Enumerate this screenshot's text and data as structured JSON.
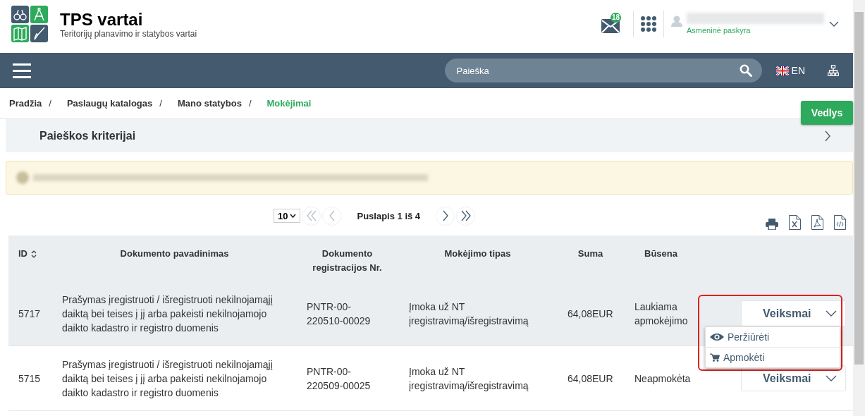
{
  "header": {
    "title": "TPS vartai",
    "subtitle": "Teritorijų planavimo ir statybos vartai",
    "mail_badge": "18",
    "account_label": "Asmeninė paskyra"
  },
  "navbar": {
    "search": {
      "placeholder": "Paieška"
    },
    "language": "EN"
  },
  "breadcrumb": [
    {
      "label": "Pradžia",
      "current": false,
      "separator": "/"
    },
    {
      "label": "Paslaugų katalogas",
      "current": false,
      "separator": "/"
    },
    {
      "label": "Mano statybos",
      "current": false,
      "separator": "/"
    },
    {
      "label": "Mokėjimai",
      "current": true
    }
  ],
  "wizard_button": "Vedlys",
  "search_panel": {
    "title": "Paieškos kriterijai",
    "expanded": false
  },
  "pagination": {
    "page_size": "10",
    "page_label": "Puslapis 1 iš 4"
  },
  "table": {
    "columns": [
      {
        "label": "ID",
        "sortable": true
      },
      {
        "label": "Dokumento pavadinimas",
        "sortable": false
      },
      {
        "label": "Dokumento registracijos Nr.",
        "sortable": false
      },
      {
        "label": "Mokėjimo tipas",
        "sortable": false
      },
      {
        "label": "Suma",
        "sortable": false
      },
      {
        "label": "Būsena",
        "sortable": false
      }
    ],
    "rows": [
      {
        "cells": [
          "5717",
          "Prašymas įregistruoti / išregistruoti nekilnojamąjį daiktą bei teises į jį arba pakeisti nekilnojamojo daikto kadastro ir registro duomenis",
          "PNTR-00-220510-00029",
          "Įmoka už NT įregistravimą/išregistravimą",
          "64,08EUR",
          "Laukiama apmokėjimo"
        ],
        "hovered": true,
        "actions": "Veiksmai",
        "menu_open": true,
        "menu": [
          {
            "kind": "view",
            "label": "Peržiūrėti"
          },
          {
            "kind": "pay",
            "label": "Apmokėti"
          }
        ]
      },
      {
        "cells": [
          "5715",
          "Prašymas įregistruoti / išregistruoti nekilnojamąjį daiktą bei teises į jį arba pakeisti nekilnojamojo daikto kadastro ir registro duomenis",
          "PNTR-00-220509-00025",
          "Įmoka už NT įregistravimą/išregistravimą",
          "64,08EUR",
          "Neapmokėta"
        ],
        "hovered": false,
        "actions": "Veiksmai",
        "menu_open": false
      }
    ]
  }
}
